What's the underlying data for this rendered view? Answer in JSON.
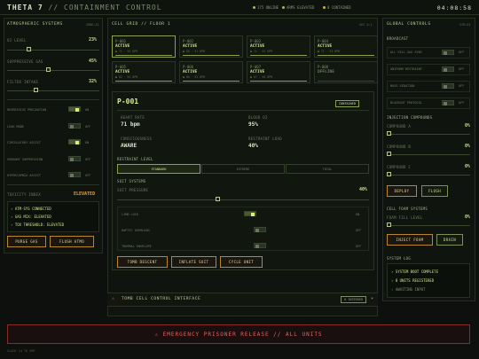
{
  "header": {
    "app": "THETA 7",
    "sep": "//",
    "title": "CONTAINMENT CONTROL",
    "status": [
      "175 ONLINE",
      "ARMS ELEVATED",
      "0 CONTAINED"
    ],
    "clock": "04:08:58"
  },
  "atmo": {
    "title": "ATMOSPHERIC SYSTEMS",
    "sub": "ZONE-A1",
    "sliders": [
      {
        "label": "O2 LEVEL",
        "value": "23%",
        "level": 0.23
      },
      {
        "label": "SUPPRESSIVE GAS",
        "value": "45%",
        "level": 0.45
      },
      {
        "label": "FILTER INTAKE",
        "value": "32%",
        "level": 0.32
      }
    ],
    "toggles": [
      {
        "label": "REGRESSIVE PRECAUTION",
        "state": "ON",
        "on": true
      },
      {
        "label": "LEAK MODE",
        "state": "OFF",
        "on": false
      },
      {
        "label": "CIRCULATORY ASSIST",
        "state": "ON",
        "on": true
      },
      {
        "label": "SENSORY SUPPRESSION",
        "state": "OFF",
        "on": false
      },
      {
        "label": "HYPERCAPNIA ASSIST",
        "state": "OFF",
        "on": false
      }
    ],
    "toxicity_label": "TOXICITY INDEX",
    "toxicity": "ELEVATED",
    "log": [
      "ATM-SYS CONNECTED",
      "GAS MIX: ELEVATED",
      "TOX THRESHOLD: ELEVATED"
    ],
    "buttons": [
      "PURGE GAS",
      "FLUSH ATMO"
    ]
  },
  "grid": {
    "title": "CELL GRID // FLOOR 1",
    "sub": "SEC A-1",
    "cells": [
      {
        "id": "P-001",
        "status": "ACTIVE",
        "meta": "● 71 · 95 BPM"
      },
      {
        "id": "P-002",
        "status": "ACTIVE",
        "meta": "● 88 · 91 BPM"
      },
      {
        "id": "P-003",
        "status": "ACTIVE",
        "meta": "● 74 · 92 BPM"
      },
      {
        "id": "P-004",
        "status": "ACTIVE",
        "meta": "● 71 · 93 BPM"
      },
      {
        "id": "P-005",
        "status": "ACTIVE",
        "meta": "● 82 · 94 BPM"
      },
      {
        "id": "P-006",
        "status": "ACTIVE",
        "meta": "● 80 · 92 BPM"
      },
      {
        "id": "P-007",
        "status": "ACTIVE",
        "meta": "● 67 · 90 BPM"
      },
      {
        "id": "P-008",
        "status": "OFFLINE",
        "meta": ""
      }
    ]
  },
  "detail": {
    "id": "P-001",
    "badge": "CONTAINED",
    "stats": [
      {
        "label": "HEART RATE",
        "value": "71 bpm"
      },
      {
        "label": "BLOOD O2",
        "value": "95%"
      },
      {
        "label": "CONSCIOUSNESS",
        "value": "AWARE"
      },
      {
        "label": "RESTRAINT LOAD",
        "value": "40%"
      }
    ],
    "restraint_title": "RESTRAINT LEVEL",
    "restraint": [
      "STANDARD",
      "EXTREME",
      "TOTAL"
    ],
    "suit_title": "SUIT SYSTEMS",
    "pressure_label": "SUIT PRESSURE",
    "pressure": "40%",
    "pressure_level": 0.4,
    "suit_toggles": [
      {
        "label": "LIMB LOCK",
        "state": "ON",
        "on": true
      },
      {
        "label": "HAPTIC OVERLOAD",
        "state": "OFF",
        "on": false
      },
      {
        "label": "THERMAL ENVELOPE",
        "state": "OFF",
        "on": false
      }
    ],
    "buttons": [
      "TOMB DESCENT",
      "INFLATE SUIT",
      "CYCLE UNIT"
    ]
  },
  "tomb": {
    "title": "TOMB CELL CONTROL INTERFACE",
    "badge": "0 INTERRED"
  },
  "global": {
    "title": "GLOBAL CONTROLS",
    "sub": "SIM-01",
    "broadcast_title": "BROADCAST",
    "broadcast": [
      {
        "label": "ALL CELL GAS SYNC",
        "state": "OFF"
      },
      {
        "label": "UNIFORM RESTRAINT",
        "state": "OFF"
      },
      {
        "label": "MASS SEDATION",
        "state": "OFF"
      },
      {
        "label": "BLACKOUT PROTOCOL",
        "state": "OFF"
      }
    ],
    "inject_title": "INJECTION COMPOUNDS",
    "compounds": [
      {
        "label": "COMPOUND A",
        "value": "0%"
      },
      {
        "label": "COMPOUND B",
        "value": "0%"
      },
      {
        "label": "COMPOUND C",
        "value": "0%"
      }
    ],
    "inject_buttons": [
      "DEPLOY",
      "FLUSH"
    ],
    "foam_title": "CELL FOAM SYSTEMS",
    "foam_label": "FOAM FILL LEVEL",
    "foam": "0%",
    "foam_buttons": [
      "INJECT FOAM",
      "DRAIN"
    ],
    "log_title": "SYSTEM LOG",
    "log": [
      "SYSTEM BOOT COMPLETE",
      "8 UNITS REGISTERED",
      "AWAITING INPUT"
    ]
  },
  "banner": {
    "text": "⚠ EMERGENCY PRISONER RELEASE // ALL UNITS"
  },
  "footer": {
    "text": "CLOCK 14 TO GMT"
  },
  "colors": {
    "accent": "#cfe28a",
    "warn": "#b9862c",
    "danger": "#e86363"
  }
}
